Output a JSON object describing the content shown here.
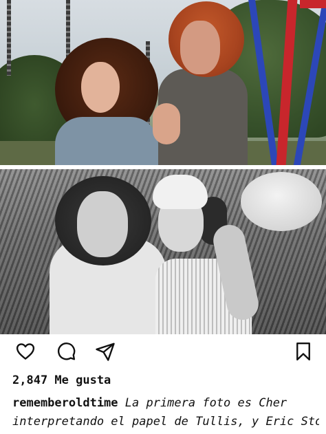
{
  "post": {
    "media": {
      "top_photo": "color-photo-two-people-on-swings",
      "bottom_photo": "black-and-white-photo-two-people-outdoors"
    },
    "actions": {
      "like_icon": "heart-icon",
      "comment_icon": "comment-bubble-icon",
      "share_icon": "send-paper-plane-icon",
      "save_icon": "bookmark-icon"
    },
    "likes_text": "2,847 Me gusta",
    "caption": {
      "username": "rememberoldtime",
      "line1_text": " La primera foto es Cher",
      "line2_text": "interpretando el papel de Tullis, y Eric Stoltz"
    }
  },
  "colors": {
    "text": "#111111",
    "background": "#ffffff"
  }
}
